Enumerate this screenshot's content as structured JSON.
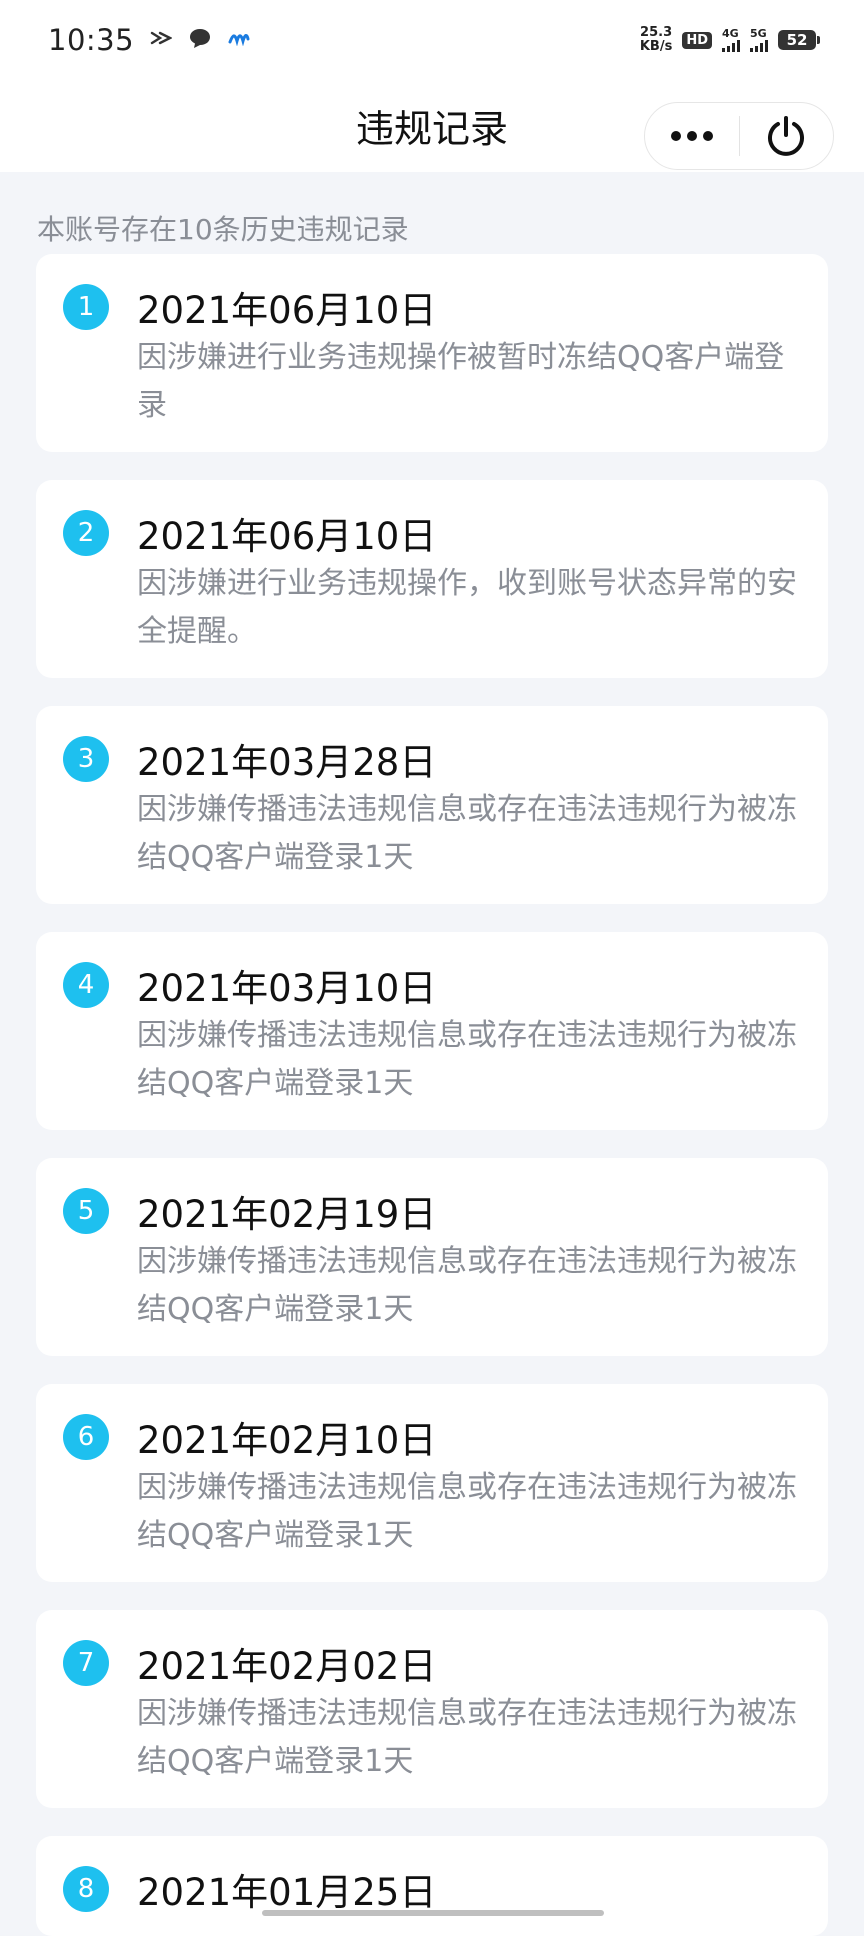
{
  "status_bar": {
    "time": "10:35",
    "net_speed_value": "25.3",
    "net_speed_unit": "KB/s",
    "hd_label": "HD",
    "sim1_label": "4G",
    "sim2_label": "5G",
    "battery": "52"
  },
  "header": {
    "title": "违规记录"
  },
  "summary_text": "本账号存在10条历史违规记录",
  "records": [
    {
      "index": "1",
      "date": "2021年06月10日",
      "desc": "因涉嫌进行业务违规操作被暂时冻结QQ客户端登录"
    },
    {
      "index": "2",
      "date": "2021年06月10日",
      "desc": "因涉嫌进行业务违规操作，收到账号状态异常的安全提醒。"
    },
    {
      "index": "3",
      "date": "2021年03月28日",
      "desc": "因涉嫌传播违法违规信息或存在违法违规行为被冻结QQ客户端登录1天"
    },
    {
      "index": "4",
      "date": "2021年03月10日",
      "desc": "因涉嫌传播违法违规信息或存在违法违规行为被冻结QQ客户端登录1天"
    },
    {
      "index": "5",
      "date": "2021年02月19日",
      "desc": "因涉嫌传播违法违规信息或存在违法违规行为被冻结QQ客户端登录1天"
    },
    {
      "index": "6",
      "date": "2021年02月10日",
      "desc": "因涉嫌传播违法违规信息或存在违法违规行为被冻结QQ客户端登录1天"
    },
    {
      "index": "7",
      "date": "2021年02月02日",
      "desc": "因涉嫌传播违法违规信息或存在违法违规行为被冻结QQ客户端登录1天"
    },
    {
      "index": "8",
      "date": "2021年01月25日",
      "desc": ""
    }
  ],
  "colors": {
    "accent": "#1ec0ef",
    "background": "#f3f5f9",
    "card": "#ffffff",
    "secondary_text": "#8a8e96"
  }
}
